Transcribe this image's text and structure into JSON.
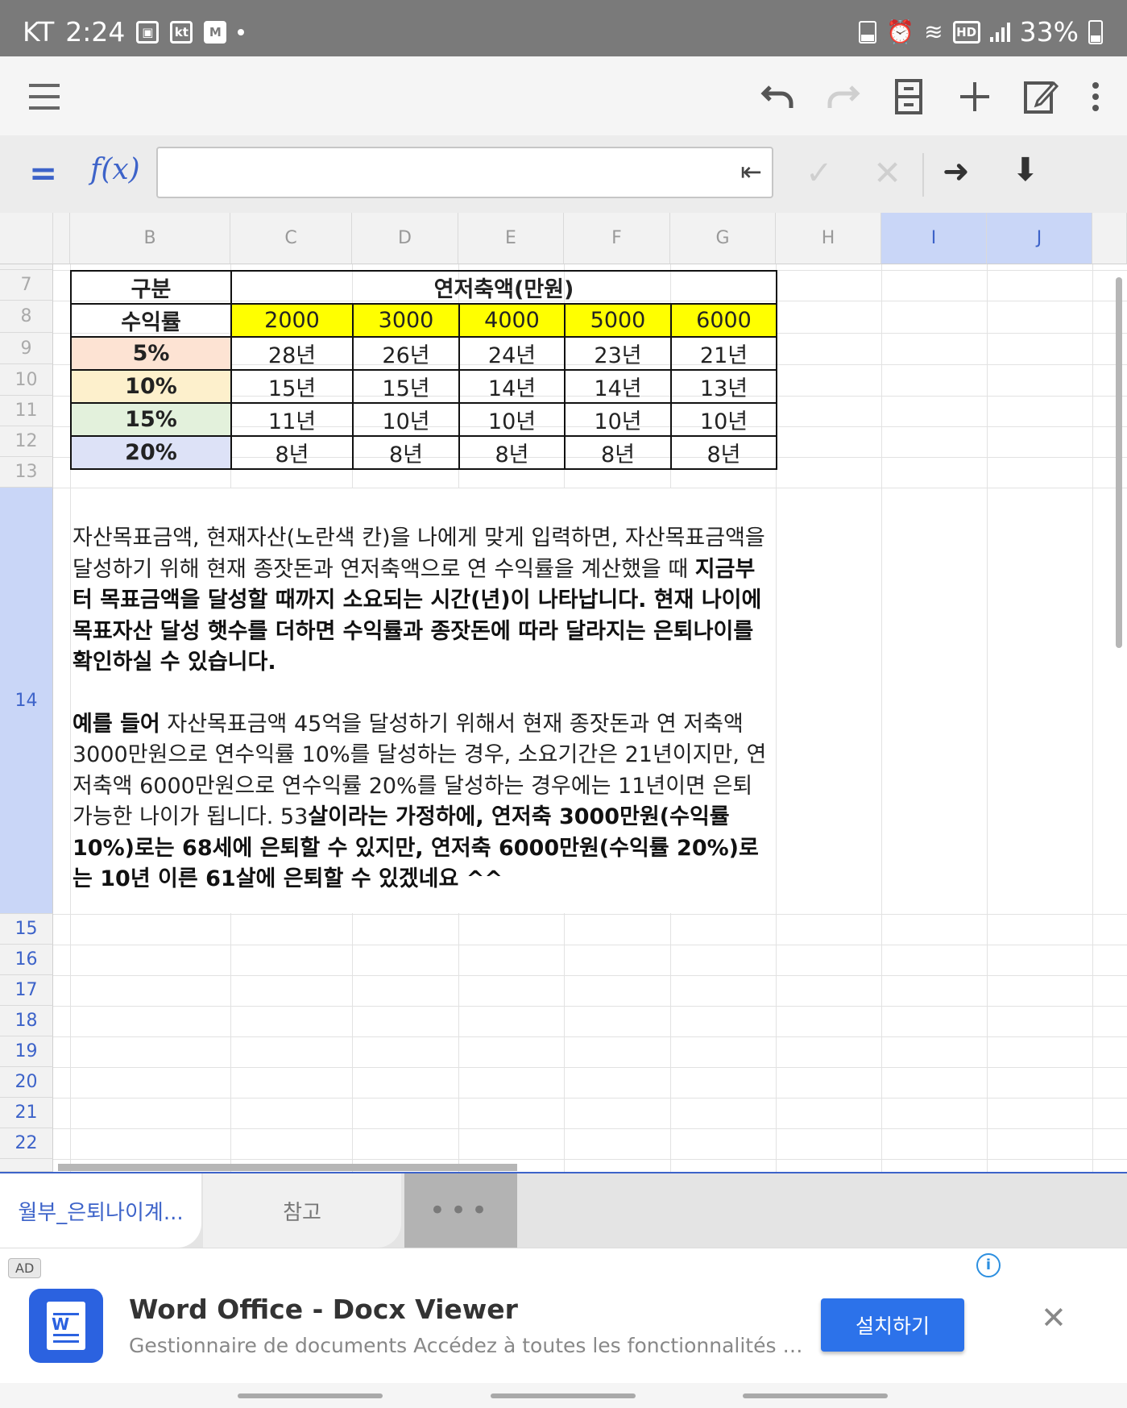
{
  "status_bar": {
    "carrier": "KT",
    "time": "2:24",
    "battery": "33%",
    "left_icons": [
      "image-icon",
      "kt-icon",
      "mstock-icon",
      "notification-dot"
    ],
    "right_icons": [
      "battery-saver-icon",
      "alarm-icon",
      "wifi-icon",
      "hd-icon",
      "signal-icon"
    ]
  },
  "toolbar": {
    "buttons": [
      "menu-icon",
      "undo-icon",
      "redo-icon",
      "sheet-icon",
      "add-icon",
      "edit-icon",
      "more-icon"
    ]
  },
  "formula_bar": {
    "equals": "=",
    "fx": "f(x)",
    "value": ""
  },
  "columns": [
    "B",
    "C",
    "D",
    "E",
    "F",
    "G",
    "H",
    "I",
    "J"
  ],
  "rows": [
    "7",
    "8",
    "9",
    "10",
    "11",
    "12",
    "13",
    "14",
    "15",
    "16",
    "17",
    "18",
    "19",
    "20",
    "21",
    "22"
  ],
  "table": {
    "header_label": "구분",
    "header_span": "연저축액(만원)",
    "row_label": "수익률",
    "amounts": [
      "2000",
      "3000",
      "4000",
      "5000",
      "6000"
    ],
    "rows": [
      {
        "rate": "5%",
        "color": "#fde3d3",
        "values": [
          "28년",
          "26년",
          "24년",
          "23년",
          "21년"
        ]
      },
      {
        "rate": "10%",
        "color": "#fdf0cc",
        "values": [
          "15년",
          "15년",
          "14년",
          "14년",
          "13년"
        ]
      },
      {
        "rate": "15%",
        "color": "#e3f1dc",
        "values": [
          "11년",
          "10년",
          "10년",
          "10년",
          "10년"
        ]
      },
      {
        "rate": "20%",
        "color": "#dde2f7",
        "values": [
          "8년",
          "8년",
          "8년",
          "8년",
          "8년"
        ]
      }
    ]
  },
  "note": {
    "p1_normal": "자산목표금액, 현재자산(노란색 칸)을 나에게 맞게 입력하면, 자산목표금액을 달성하기 위해 현재 종잣돈과 연저축액으로 연 수익률을 계산했을 때 ",
    "p1_bold": "지금부터 목표금액을 달성할 때까지 소요되는 시간(년)이 나타납니다. 현재 나이에 목표자산 달성 햇수를 더하면 수익률과 종잣돈에 따라 달라지는 은퇴나이를 확인하실 수 있습니다.",
    "p2_bold_lead": "예를 들어",
    "p2_normal": " 자산목표금액 45억을 달성하기 위해서 현재 종잣돈과 연 저축액 3000만원으로 연수익률 10%를 달성하는 경우, 소요기간은 21년이지만, 연저축액 6000만원으로 연수익률 20%를 달성하는 경우에는 11년이면 은퇴 가능한 나이가 됩니다. 53",
    "p2_bold": "살이라는 가정하에, 연저축 3000만원(수익률 10%)로는 68세에 은퇴할 수 있지만, 연저축 6000만원(수익률 20%)로는 10년 이른 61살에 은퇴할 수 있겠네요 ^^"
  },
  "sheet_tabs": {
    "active": "월부_은퇴나이계...",
    "other": "참고",
    "more": "•••"
  },
  "ad": {
    "badge": "AD",
    "title": "Word Office - Docx Viewer",
    "description": "Gestionnaire de documents Accédez à toutes les fonctionnalités sans Int...",
    "install": "설치하기",
    "logo_text": "W"
  }
}
